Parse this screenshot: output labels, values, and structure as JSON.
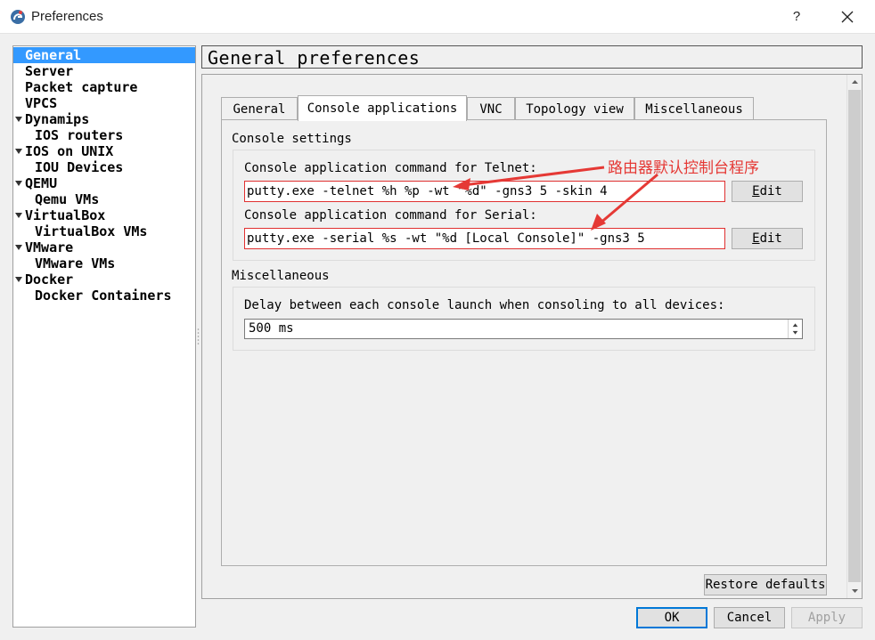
{
  "window": {
    "title": "Preferences",
    "help_label": "?",
    "close_icon": "close-icon",
    "app_icon": "gns3-icon"
  },
  "tree": {
    "items": [
      {
        "label": "General",
        "level": 0,
        "expanded": false,
        "selected": true
      },
      {
        "label": "Server",
        "level": 0,
        "expanded": false,
        "selected": false
      },
      {
        "label": "Packet capture",
        "level": 0,
        "expanded": false,
        "selected": false
      },
      {
        "label": "VPCS",
        "level": 0,
        "expanded": false,
        "selected": false
      },
      {
        "label": "Dynamips",
        "level": 0,
        "expanded": true,
        "selected": false
      },
      {
        "label": "IOS routers",
        "level": 1,
        "expanded": false,
        "selected": false
      },
      {
        "label": "IOS on UNIX",
        "level": 0,
        "expanded": true,
        "selected": false
      },
      {
        "label": "IOU Devices",
        "level": 1,
        "expanded": false,
        "selected": false
      },
      {
        "label": "QEMU",
        "level": 0,
        "expanded": true,
        "selected": false
      },
      {
        "label": "Qemu VMs",
        "level": 1,
        "expanded": false,
        "selected": false
      },
      {
        "label": "VirtualBox",
        "level": 0,
        "expanded": true,
        "selected": false
      },
      {
        "label": "VirtualBox VMs",
        "level": 1,
        "expanded": false,
        "selected": false
      },
      {
        "label": "VMware",
        "level": 0,
        "expanded": true,
        "selected": false
      },
      {
        "label": "VMware VMs",
        "level": 1,
        "expanded": false,
        "selected": false
      },
      {
        "label": "Docker",
        "level": 0,
        "expanded": true,
        "selected": false
      },
      {
        "label": "Docker Containers",
        "level": 1,
        "expanded": false,
        "selected": false
      }
    ]
  },
  "page": {
    "title": "General preferences"
  },
  "tabs": [
    {
      "label": "General",
      "active": false
    },
    {
      "label": "Console applications",
      "active": true
    },
    {
      "label": "VNC",
      "active": false
    },
    {
      "label": "Topology view",
      "active": false
    },
    {
      "label": "Miscellaneous",
      "active": false
    }
  ],
  "console_settings": {
    "group_label": "Console settings",
    "telnet_label": "Console application command for Telnet:",
    "telnet_value": "putty.exe -telnet %h %p -wt \"%d\" -gns3 5 -skin 4",
    "serial_label": "Console application command for Serial:",
    "serial_value": "putty.exe -serial %s -wt \"%d [Local Console]\" -gns3 5",
    "edit_label": "Edit"
  },
  "miscellaneous": {
    "group_label": "Miscellaneous",
    "delay_label": "Delay between each console launch when consoling to all devices:",
    "delay_value": "500 ms"
  },
  "annotation": {
    "text": "路由器默认控制台程序",
    "color": "#e53935"
  },
  "buttons": {
    "restore_defaults": "Restore defaults",
    "ok": "OK",
    "cancel": "Cancel",
    "apply": "Apply"
  },
  "colors": {
    "selection": "#3399ff",
    "default_button_border": "#0078d7",
    "highlight_border": "#e03030"
  }
}
